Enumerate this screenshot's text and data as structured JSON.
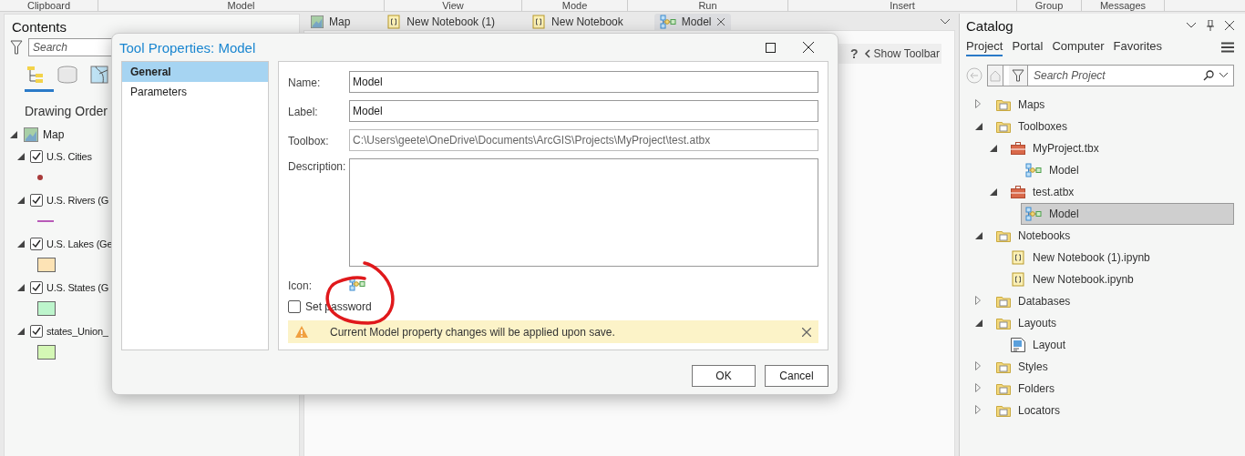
{
  "ribbon_groups": [
    "Clipboard",
    "Model",
    "View",
    "Mode",
    "Run",
    "Insert",
    "Group",
    "Messages"
  ],
  "contents": {
    "title": "Contents",
    "search": {
      "placeholder": "Search"
    },
    "heading": "Drawing Order",
    "map": {
      "label": "Map",
      "expanded": true,
      "layers": [
        {
          "label": "U.S. Cities",
          "checked": true,
          "expanded": true,
          "kind": "point",
          "color": "#a83a3a"
        },
        {
          "label": "U.S. Rivers (G",
          "checked": true,
          "expanded": true,
          "kind": "line",
          "color": "#b85ab8"
        },
        {
          "label": "U.S. Lakes (Ge",
          "checked": true,
          "expanded": true,
          "kind": "fill",
          "color": "#fde3b5"
        },
        {
          "label": "U.S. States (G",
          "checked": true,
          "expanded": true,
          "kind": "fill",
          "color": "#bdf5cc"
        },
        {
          "label": "states_Union_",
          "checked": true,
          "expanded": true,
          "kind": "fill",
          "color": "#d4f7b5"
        }
      ]
    }
  },
  "view_tabs": [
    {
      "label": "Map",
      "kind": "map",
      "selected": false
    },
    {
      "label": "New Notebook (1)",
      "kind": "notebook",
      "selected": false
    },
    {
      "label": "New Notebook",
      "kind": "notebook",
      "selected": false
    },
    {
      "label": "Model",
      "kind": "model",
      "selected": true,
      "closable": true
    }
  ],
  "view_toolbar": {
    "help": "?",
    "show_toolbar": "Show Toolbar"
  },
  "dialog": {
    "title": "Tool Properties: Model",
    "nav": [
      {
        "label": "General",
        "selected": true
      },
      {
        "label": "Parameters",
        "selected": false
      }
    ],
    "fields": [
      {
        "label": "Name:",
        "value": "Model",
        "disabled": false
      },
      {
        "label": "Label:",
        "value": "Model",
        "disabled": false
      },
      {
        "label": "Toolbox:",
        "value": "C:\\Users\\geete\\OneDrive\\Documents\\ArcGIS\\Projects\\MyProject\\test.atbx",
        "disabled": true
      }
    ],
    "description": {
      "label": "Description:"
    },
    "icon_label": "Icon:",
    "set_password": {
      "label": "Set password",
      "checked": false
    },
    "warning": "Current Model property changes will be applied upon save.",
    "buttons": [
      "OK",
      "Cancel"
    ]
  },
  "catalog": {
    "title": "Catalog",
    "tabs": [
      {
        "label": "Project",
        "selected": true
      },
      {
        "label": "Portal",
        "selected": false
      },
      {
        "label": "Computer",
        "selected": false
      },
      {
        "label": "Favorites",
        "selected": false
      }
    ],
    "search": {
      "placeholder": "Search Project"
    },
    "tree": [
      {
        "label": "Maps",
        "kind": "folder",
        "expanded": false,
        "selected": false
      },
      {
        "label": "Toolboxes",
        "kind": "folder",
        "expanded": true,
        "selected": false,
        "children": [
          {
            "label": "MyProject.tbx",
            "kind": "toolbox",
            "expanded": true,
            "selected": false,
            "children": [
              {
                "label": "Model",
                "kind": "model",
                "selected": false
              }
            ]
          },
          {
            "label": "test.atbx",
            "kind": "toolbox",
            "expanded": true,
            "selected": false,
            "children": [
              {
                "label": "Model",
                "kind": "model",
                "selected": true
              }
            ]
          }
        ]
      },
      {
        "label": "Notebooks",
        "kind": "folder",
        "expanded": true,
        "selected": false,
        "children": [
          {
            "label": "New Notebook (1).ipynb",
            "kind": "notebook",
            "selected": false
          },
          {
            "label": "New Notebook.ipynb",
            "kind": "notebook",
            "selected": false
          }
        ]
      },
      {
        "label": "Databases",
        "kind": "folder",
        "expanded": false,
        "selected": false
      },
      {
        "label": "Layouts",
        "kind": "folder",
        "expanded": true,
        "selected": false,
        "children": [
          {
            "label": "Layout",
            "kind": "layout",
            "selected": false
          }
        ]
      },
      {
        "label": "Styles",
        "kind": "folder",
        "expanded": false,
        "selected": false
      },
      {
        "label": "Folders",
        "kind": "folder",
        "expanded": false,
        "selected": false
      },
      {
        "label": "Locators",
        "kind": "folder",
        "expanded": false,
        "selected": false
      }
    ]
  }
}
